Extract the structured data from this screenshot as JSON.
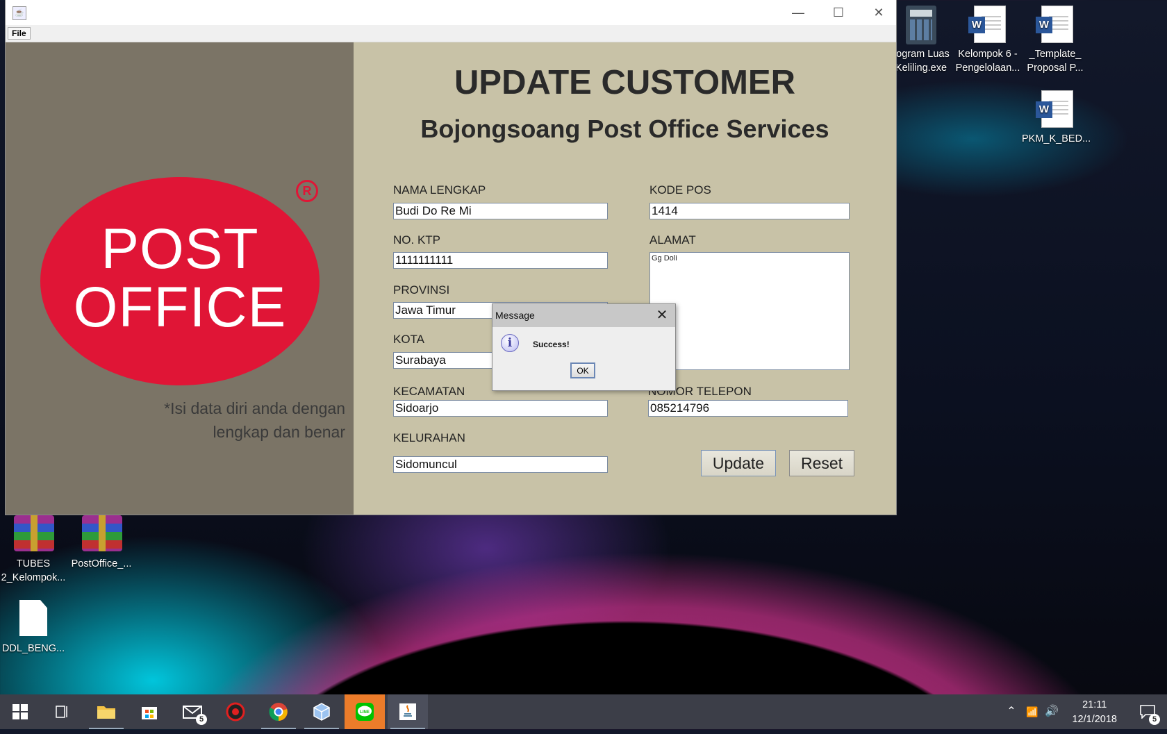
{
  "desktop": {
    "icons": [
      {
        "label": "rogram Luas\nKeliling.exe"
      },
      {
        "label": "Kelompok 6 -\nPengelolaan..."
      },
      {
        "label": "_Template_\nProposal P..."
      },
      {
        "label": "PKM_K_BED..."
      },
      {
        "label": "TUBES\n2_Kelompok..."
      },
      {
        "label": "PostOffice_..."
      },
      {
        "label": "DDL_BENG..."
      }
    ]
  },
  "window": {
    "menu_file": "File",
    "controls": {
      "minimize": "—",
      "maximize": "☐",
      "close": "✕"
    },
    "logo": {
      "line1": "POST",
      "line2": "OFFICE",
      "registered": "R"
    },
    "note": {
      "line1": "*Isi data diri anda dengan",
      "line2": "lengkap dan benar"
    },
    "title": "UPDATE CUSTOMER",
    "subtitle": "Bojongsoang Post Office Services",
    "fields": {
      "nama_lengkap": {
        "label": "NAMA LENGKAP",
        "value": "Budi Do Re Mi"
      },
      "no_ktp": {
        "label": "NO. KTP",
        "value": "1111111111"
      },
      "provinsi": {
        "label": "PROVINSI",
        "value": "Jawa Timur"
      },
      "kota": {
        "label": "KOTA",
        "value": "Surabaya"
      },
      "kecamatan": {
        "label": "KECAMATAN",
        "value": "Sidoarjo"
      },
      "kelurahan": {
        "label": "KELURAHAN",
        "value": "Sidomuncul"
      },
      "kode_pos": {
        "label": "KODE POS",
        "value": "1414"
      },
      "alamat": {
        "label": "ALAMAT",
        "value": "Gg Doli"
      },
      "nomor_telepon": {
        "label": "NOMOR TELEPON",
        "value": "085214796"
      }
    },
    "buttons": {
      "update": "Update",
      "reset": "Reset"
    }
  },
  "dialog": {
    "title": "Message",
    "message": "Success!",
    "ok": "OK",
    "close": "✕"
  },
  "taskbar": {
    "mail_badge": "5",
    "notification_badge": "5",
    "clock": {
      "time": "21:11",
      "date": "12/1/2018"
    }
  }
}
